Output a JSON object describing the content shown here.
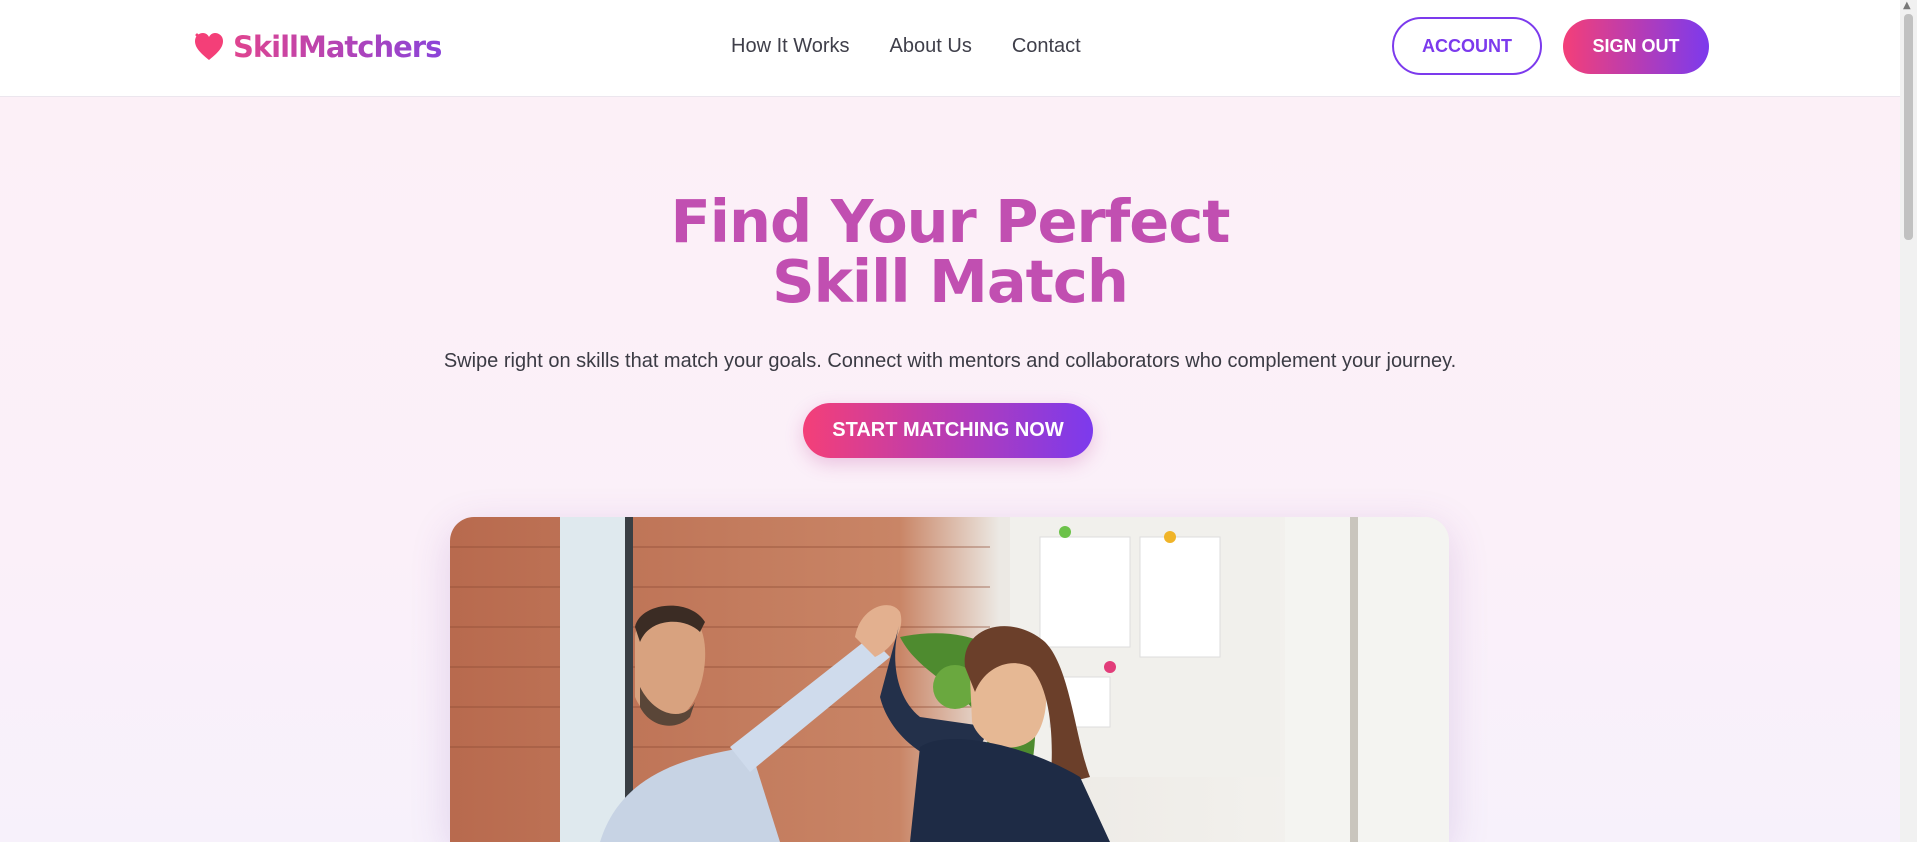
{
  "brand": {
    "name": "SkillMatchers",
    "logo_icon": "heart-icon",
    "accent": "#e0448f",
    "accent2": "#7c3aed"
  },
  "nav": {
    "items": [
      {
        "label": "How It Works"
      },
      {
        "label": "About Us"
      },
      {
        "label": "Contact"
      }
    ]
  },
  "header": {
    "account_label": "ACCOUNT",
    "signout_label": "SIGN OUT"
  },
  "hero": {
    "title_line1": "Find Your Perfect",
    "title_line2": "Skill Match",
    "subtitle": "Swipe right on skills that match your goals. Connect with mentors and collaborators who complement your journey.",
    "cta_label": "START MATCHING NOW"
  }
}
